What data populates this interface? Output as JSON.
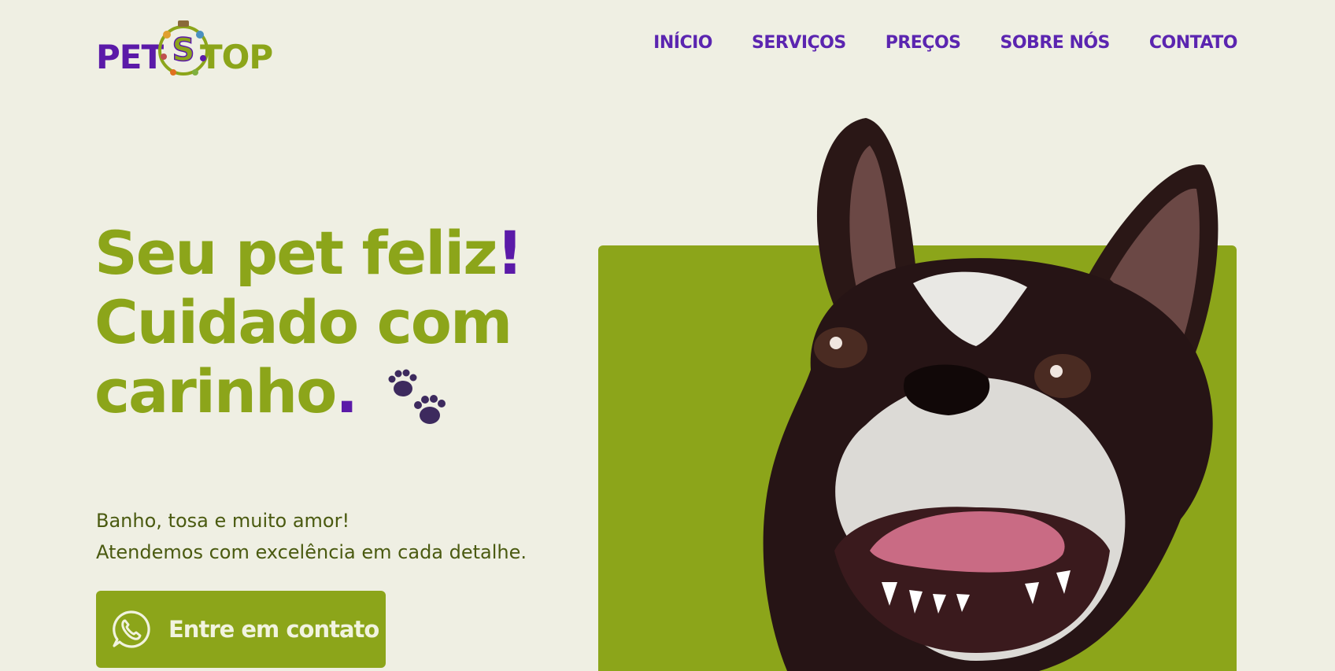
{
  "brand": {
    "logo_alt": "PET STOP",
    "logo_pet": "PET",
    "logo_top": "TOP",
    "logo_s": "S",
    "colors": {
      "green": "#8ca51a",
      "purple": "#5b1aa8",
      "background": "#efefe3"
    }
  },
  "nav": {
    "items": [
      {
        "label": "INÍCIO"
      },
      {
        "label": "SERVIÇOS"
      },
      {
        "label": "PREÇOS"
      },
      {
        "label": "SOBRE NÓS"
      },
      {
        "label": "CONTATO"
      }
    ]
  },
  "hero": {
    "line1": "Seu pet feliz",
    "line1_accent": "!",
    "line2": "Cuidado com",
    "line3": "carinho",
    "line3_accent": ".",
    "paws_icon": "paw-prints-icon",
    "subtext_line1": "Banho, tosa e muito amor!",
    "subtext_line2": "Atendemos com excelência em cada detalhe.",
    "cta_label": "Entre em contato",
    "cta_icon": "whatsapp-icon",
    "image_alt": "dog photo (Boston terrier)"
  }
}
